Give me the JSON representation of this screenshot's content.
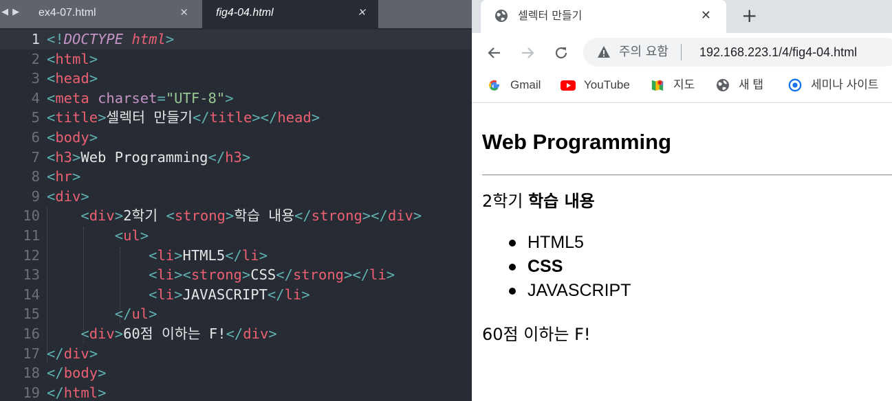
{
  "editor": {
    "tabs": [
      {
        "label": "ex4-07.html",
        "close": "✕"
      },
      {
        "label": "fig4-04.html",
        "close": "✕"
      }
    ],
    "line_numbers": [
      "1",
      "2",
      "3",
      "4",
      "5",
      "6",
      "7",
      "8",
      "9",
      "10",
      "11",
      "12",
      "13",
      "14",
      "15",
      "16",
      "17",
      "18",
      "19"
    ],
    "lines": [
      [
        [
          "pun",
          "<!"
        ],
        [
          "doc",
          "DOCTYPE"
        ],
        [
          "txt",
          " "
        ],
        [
          "doc2",
          "html"
        ],
        [
          "pun",
          ">"
        ]
      ],
      [
        [
          "pun",
          "<"
        ],
        [
          "tag",
          "html"
        ],
        [
          "pun",
          ">"
        ]
      ],
      [
        [
          "pun",
          "<"
        ],
        [
          "tag",
          "head"
        ],
        [
          "pun",
          ">"
        ]
      ],
      [
        [
          "pun",
          "<"
        ],
        [
          "tag",
          "meta"
        ],
        [
          "txt",
          " "
        ],
        [
          "attr",
          "charset"
        ],
        [
          "pun",
          "="
        ],
        [
          "str",
          "\"UTF-8\""
        ],
        [
          "pun",
          ">"
        ]
      ],
      [
        [
          "pun",
          "<"
        ],
        [
          "tag",
          "title"
        ],
        [
          "pun",
          ">"
        ],
        [
          "txt",
          "셀렉터 만들기"
        ],
        [
          "pun",
          "</"
        ],
        [
          "tag",
          "title"
        ],
        [
          "pun",
          "></"
        ],
        [
          "tag",
          "head"
        ],
        [
          "pun",
          ">"
        ]
      ],
      [
        [
          "pun",
          "<"
        ],
        [
          "tag",
          "body"
        ],
        [
          "pun",
          ">"
        ]
      ],
      [
        [
          "pun",
          "<"
        ],
        [
          "tag",
          "h3"
        ],
        [
          "pun",
          ">"
        ],
        [
          "txt",
          "Web Programming"
        ],
        [
          "pun",
          "</"
        ],
        [
          "tag",
          "h3"
        ],
        [
          "pun",
          ">"
        ]
      ],
      [
        [
          "pun",
          "<"
        ],
        [
          "tag",
          "hr"
        ],
        [
          "pun",
          ">"
        ]
      ],
      [
        [
          "pun",
          "<"
        ],
        [
          "tag",
          "div"
        ],
        [
          "pun",
          ">"
        ]
      ],
      [
        [
          "txt",
          "    "
        ],
        [
          "pun",
          "<"
        ],
        [
          "tag",
          "div"
        ],
        [
          "pun",
          ">"
        ],
        [
          "txt",
          "2학기 "
        ],
        [
          "pun",
          "<"
        ],
        [
          "tag",
          "strong"
        ],
        [
          "pun",
          ">"
        ],
        [
          "txt",
          "학습 내용"
        ],
        [
          "pun",
          "</"
        ],
        [
          "tag",
          "strong"
        ],
        [
          "pun",
          "></"
        ],
        [
          "tag",
          "div"
        ],
        [
          "pun",
          ">"
        ]
      ],
      [
        [
          "txt",
          "        "
        ],
        [
          "pun",
          "<"
        ],
        [
          "tag",
          "ul"
        ],
        [
          "pun",
          ">"
        ]
      ],
      [
        [
          "txt",
          "            "
        ],
        [
          "pun",
          "<"
        ],
        [
          "tag",
          "li"
        ],
        [
          "pun",
          ">"
        ],
        [
          "txt",
          "HTML5"
        ],
        [
          "pun",
          "</"
        ],
        [
          "tag",
          "li"
        ],
        [
          "pun",
          ">"
        ]
      ],
      [
        [
          "txt",
          "            "
        ],
        [
          "pun",
          "<"
        ],
        [
          "tag",
          "li"
        ],
        [
          "pun",
          "><"
        ],
        [
          "tag",
          "strong"
        ],
        [
          "pun",
          ">"
        ],
        [
          "txt",
          "CSS"
        ],
        [
          "pun",
          "</"
        ],
        [
          "tag",
          "strong"
        ],
        [
          "pun",
          "></"
        ],
        [
          "tag",
          "li"
        ],
        [
          "pun",
          ">"
        ]
      ],
      [
        [
          "txt",
          "            "
        ],
        [
          "pun",
          "<"
        ],
        [
          "tag",
          "li"
        ],
        [
          "pun",
          ">"
        ],
        [
          "txt",
          "JAVASCRIPT"
        ],
        [
          "pun",
          "</"
        ],
        [
          "tag",
          "li"
        ],
        [
          "pun",
          ">"
        ]
      ],
      [
        [
          "txt",
          "        "
        ],
        [
          "pun",
          "</"
        ],
        [
          "tag",
          "ul"
        ],
        [
          "pun",
          ">"
        ]
      ],
      [
        [
          "txt",
          "    "
        ],
        [
          "pun",
          "<"
        ],
        [
          "tag",
          "div"
        ],
        [
          "pun",
          ">"
        ],
        [
          "txt",
          "60점 이하는 F!"
        ],
        [
          "pun",
          "</"
        ],
        [
          "tag",
          "div"
        ],
        [
          "pun",
          ">"
        ]
      ],
      [
        [
          "pun",
          "</"
        ],
        [
          "tag",
          "div"
        ],
        [
          "pun",
          ">"
        ]
      ],
      [
        [
          "pun",
          "</"
        ],
        [
          "tag",
          "body"
        ],
        [
          "pun",
          ">"
        ]
      ],
      [
        [
          "pun",
          "</"
        ],
        [
          "tag",
          "html"
        ],
        [
          "pun",
          ">"
        ]
      ]
    ]
  },
  "browser": {
    "tab_title": "셀렉터 만들기",
    "tab_close": "✕",
    "new_tab": "+",
    "security_label": "주의 요함",
    "url": "192.168.223.1/4/fig4-04.html",
    "bookmarks": [
      {
        "label": "Gmail",
        "icon": "google-icon"
      },
      {
        "label": "YouTube",
        "icon": "youtube-icon"
      },
      {
        "label": "지도",
        "icon": "maps-icon"
      },
      {
        "label": "새 탭",
        "icon": "globe-icon"
      },
      {
        "label": "세미나 사이트",
        "icon": "seminar-icon"
      }
    ],
    "page": {
      "h3": "Web Programming",
      "line1_prefix": "2학기 ",
      "line1_strong": "학습 내용",
      "list": [
        "HTML5",
        "CSS",
        "JAVASCRIPT"
      ],
      "line2": "60점 이하는 F!"
    }
  },
  "colors": {
    "editor_bg": "#272b33",
    "tag": "#ec6073",
    "punctuation": "#5fb3b3",
    "attribute": "#c594c5",
    "string": "#99c794"
  }
}
